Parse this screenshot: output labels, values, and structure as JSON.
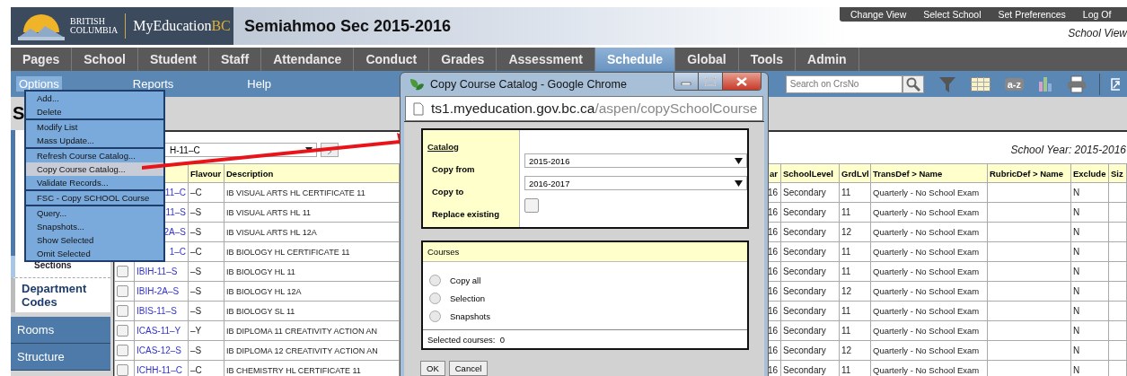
{
  "header": {
    "logo": {
      "line1": "BRITISH",
      "line2": "COLUMBIA",
      "wordmark": "MyEducation",
      "wordmark_accent": "BC"
    },
    "title": "Semiahmoo Sec 2015-2016",
    "links": [
      "Change View",
      "Select School",
      "Set Preferences",
      "Log Of"
    ],
    "view": "School View"
  },
  "nav": {
    "tabs": [
      {
        "label": "Pages",
        "selected": false
      },
      {
        "label": "School",
        "selected": false
      },
      {
        "label": "Student",
        "selected": false
      },
      {
        "label": "Staff",
        "selected": false
      },
      {
        "label": "Attendance",
        "selected": false
      },
      {
        "label": "Conduct",
        "selected": false
      },
      {
        "label": "Grades",
        "selected": false
      },
      {
        "label": "Assessment",
        "selected": false
      },
      {
        "label": "Schedule",
        "selected": true
      },
      {
        "label": "Global",
        "selected": false
      },
      {
        "label": "Tools",
        "selected": false
      },
      {
        "label": "Admin",
        "selected": false
      }
    ]
  },
  "subnav": {
    "items": [
      {
        "label": "Options",
        "selected": true
      },
      {
        "label": "Reports",
        "selected": false
      },
      {
        "label": "Help",
        "selected": false
      }
    ],
    "search": {
      "placeholder": "Search on CrsNo"
    },
    "sort_label": "a-z"
  },
  "options_menu": {
    "groups": [
      {
        "items": [
          {
            "label": "Add...",
            "selected": false
          },
          {
            "label": "Delete",
            "selected": false
          }
        ]
      },
      {
        "items": [
          {
            "label": "Modify List",
            "selected": false
          },
          {
            "label": "Mass Update...",
            "selected": false
          }
        ]
      },
      {
        "items": [
          {
            "label": "Refresh Course Catalog...",
            "selected": false
          },
          {
            "label": "Copy Course Catalog...",
            "selected": true
          },
          {
            "label": "Validate Records...",
            "selected": false
          }
        ]
      },
      {
        "items": [
          {
            "label": "FSC - Copy SCHOOL Course",
            "selected": false
          }
        ]
      },
      {
        "items": [
          {
            "label": "Query...",
            "selected": false
          },
          {
            "label": "Snapshots...",
            "selected": false
          },
          {
            "label": "Show Selected",
            "selected": false
          },
          {
            "label": "Omit Selected",
            "selected": false
          }
        ]
      }
    ]
  },
  "page_title": "S",
  "sidebar": {
    "items": [
      {
        "label": "Sections",
        "kind": "subitem"
      },
      {
        "label": "Department Codes",
        "kind": "section"
      },
      {
        "label": "Rooms",
        "kind": "tab"
      },
      {
        "label": "Structure",
        "kind": "tab"
      }
    ]
  },
  "content": {
    "course_select": {
      "value": "H-11–C"
    },
    "school_year": "School Year: 2015-2016",
    "table": {
      "columns": [
        "Flavour",
        "Description",
        "ar",
        "SchoolLevel",
        "GrdLvl",
        "TransDef > Name",
        "RubricDef > Name",
        "Exclude",
        "Siz"
      ],
      "rows": [
        {
          "kind": "covered",
          "code": "11–C",
          "flavour": "–C",
          "description": "IB VISUAL ARTS HL CERTIFICATE 11",
          "year": "16",
          "level": "Secondary",
          "grade": "11",
          "transdef": "Quarterly - No School Exam",
          "exclude": "N"
        },
        {
          "kind": "covered",
          "code": "11–S",
          "flavour": "–S",
          "description": "IB VISUAL ARTS HL 11",
          "year": "16",
          "level": "Secondary",
          "grade": "11",
          "transdef": "Quarterly - No School Exam",
          "exclude": "N"
        },
        {
          "kind": "covered",
          "code": "2A–S",
          "flavour": "–S",
          "description": "IB VISUAL ARTS HL 12A",
          "year": "16",
          "level": "Secondary",
          "grade": "12",
          "transdef": "Quarterly - No School Exam",
          "exclude": "N"
        },
        {
          "kind": "covered",
          "code": "1–C",
          "flavour": "–C",
          "description": "IB BIOLOGY HL CERTIFICATE 11",
          "year": "16",
          "level": "Secondary",
          "grade": "11",
          "transdef": "Quarterly - No School Exam",
          "exclude": "N"
        },
        {
          "kind": "full",
          "checked": false,
          "code": "IBIH-11–S",
          "flavour": "–S",
          "description": "IB BIOLOGY HL 11",
          "year": "16",
          "level": "Secondary",
          "grade": "11",
          "transdef": "Quarterly - No School Exam",
          "exclude": "N"
        },
        {
          "kind": "full",
          "checked": false,
          "code": "IBIH-2A–S",
          "flavour": "–S",
          "description": "IB BIOLOGY HL 12A",
          "year": "16",
          "level": "Secondary",
          "grade": "12",
          "transdef": "Quarterly - No School Exam",
          "exclude": "N"
        },
        {
          "kind": "full",
          "checked": false,
          "code": "IBIS-11–S",
          "flavour": "–S",
          "description": "IB BIOLOGY SL 11",
          "year": "16",
          "level": "Secondary",
          "grade": "11",
          "transdef": "Quarterly - No School Exam",
          "exclude": "N"
        },
        {
          "kind": "full",
          "checked": false,
          "code": "ICAS-11–Y",
          "flavour": "–Y",
          "description": "IB DIPLOMA 11 CREATIVITY ACTION AN",
          "year": "16",
          "level": "Secondary",
          "grade": "11",
          "transdef": "Quarterly - No School Exam",
          "exclude": "N"
        },
        {
          "kind": "full",
          "checked": false,
          "code": "ICAS-12–S",
          "flavour": "–S",
          "description": "IB DIPLOMA 12 CREATIVITY ACTION AN",
          "year": "16",
          "level": "Secondary",
          "grade": "12",
          "transdef": "Quarterly - No School Exam",
          "exclude": "N"
        },
        {
          "kind": "full",
          "checked": false,
          "code": "ICHH-11–C",
          "flavour": "–C",
          "description": "IB CHEMISTRY HL CERTIFICATE 11",
          "year": "16",
          "level": "Secondary",
          "grade": "11",
          "transdef": "Quarterly - No School Exam",
          "exclude": "N"
        }
      ]
    }
  },
  "dialog": {
    "title": "Copy Course Catalog - Google Chrome",
    "url_host": "ts1.myeducation.gov.bc.ca",
    "url_path": "/aspen/copySchoolCourse",
    "catalog": {
      "heading": "Catalog",
      "copy_from": {
        "label": "Copy from",
        "value": "2015-2016"
      },
      "copy_to": {
        "label": "Copy to",
        "value": "2016-2017"
      },
      "replace": {
        "label": "Replace existing",
        "checked": false
      }
    },
    "courses": {
      "heading": "Courses",
      "options": [
        {
          "label": "Copy all",
          "selected": false
        },
        {
          "label": "Selection",
          "selected": false
        },
        {
          "label": "Snapshots",
          "selected": false
        }
      ],
      "footer": "Selected courses:  0"
    },
    "buttons": [
      "OK",
      "Cancel"
    ]
  }
}
